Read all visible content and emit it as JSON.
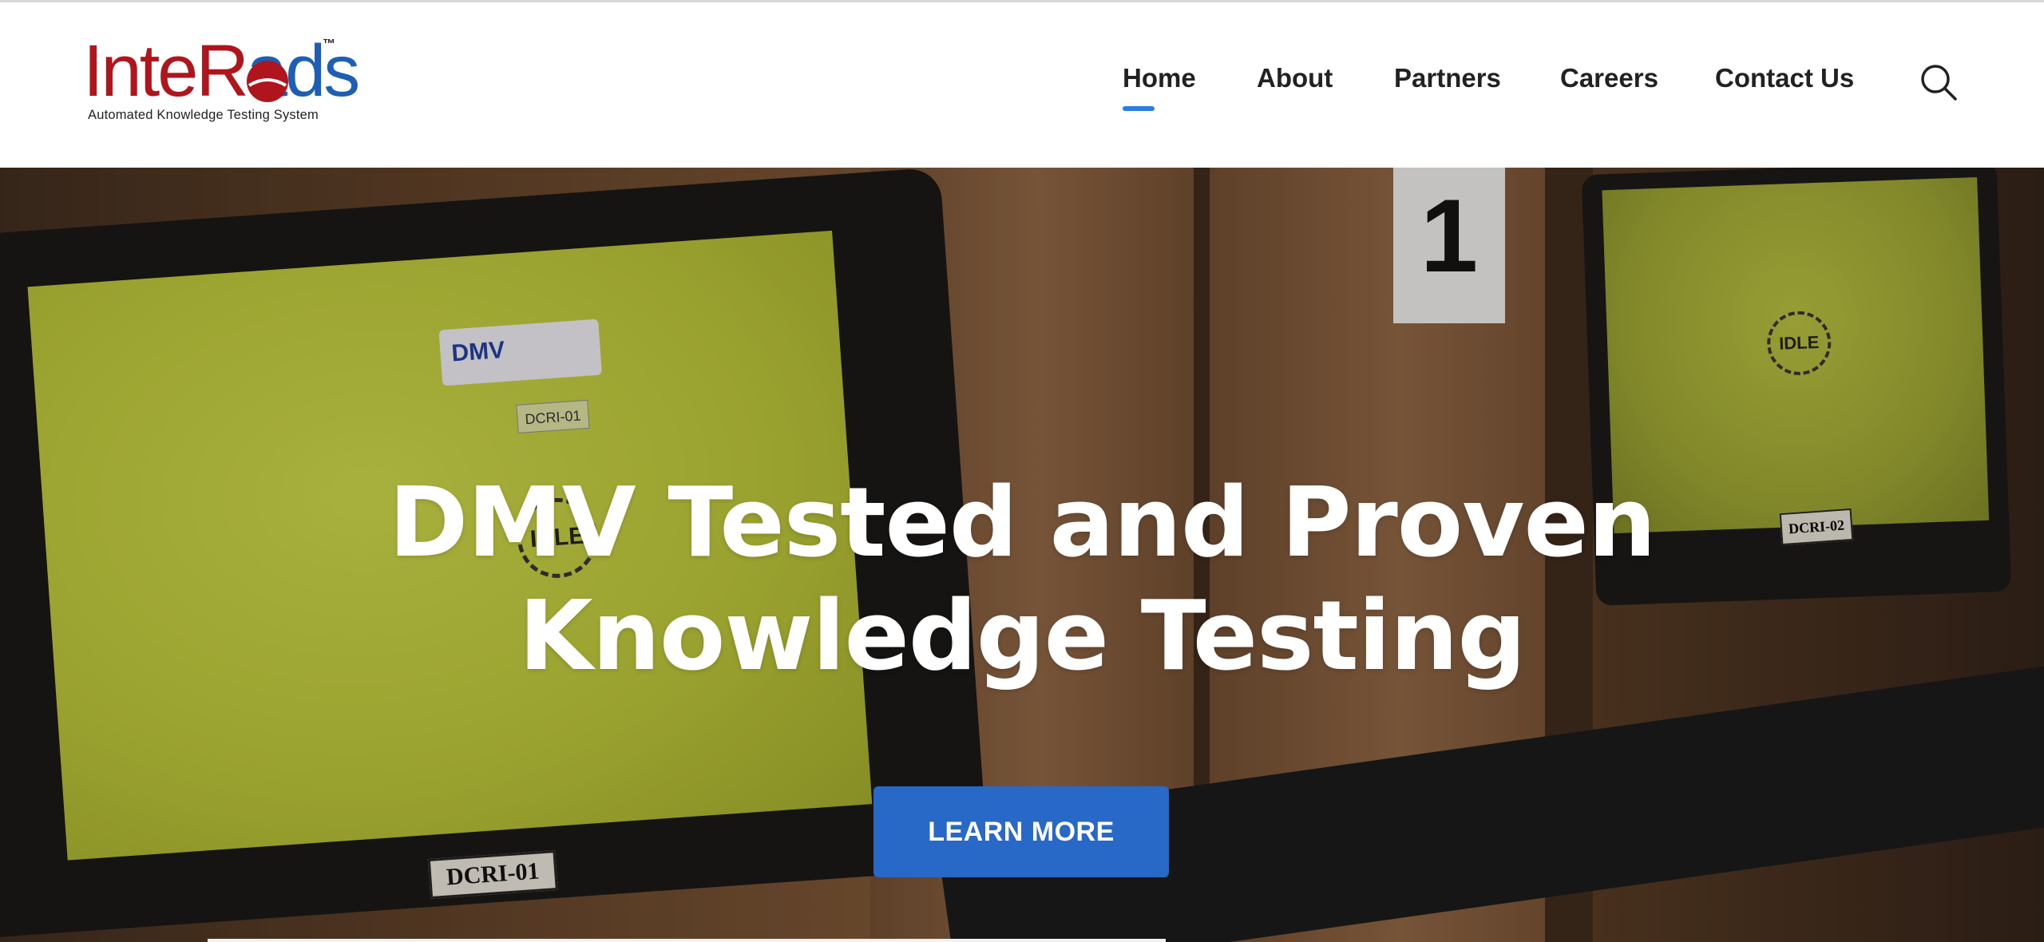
{
  "logo": {
    "part1": "Inte",
    "part2": "R",
    "part3": "ads",
    "tm": "™",
    "tagline": "Automated Knowledge Testing System"
  },
  "nav": {
    "items": [
      {
        "label": "Home",
        "active": true
      },
      {
        "label": "About",
        "active": false
      },
      {
        "label": "Partners",
        "active": false
      },
      {
        "label": "Careers",
        "active": false
      },
      {
        "label": "Contact Us",
        "active": false
      }
    ],
    "search_icon": "search-icon"
  },
  "hero": {
    "title_line1": "DMV Tested and Proven",
    "title_line2": "Knowledge Testing",
    "button_label": "LEARN MORE",
    "photo": {
      "dmv_badge": "DMV",
      "idle_text": "IDLE",
      "station_tag": "DCRI-01",
      "monitor_label": "DCRI-01",
      "monitor_label_right": "DCRI-02",
      "booth_number": "1"
    }
  },
  "colors": {
    "accent": "#2b7de0",
    "button": "#2869c7",
    "logo_blue": "#1e5fb4",
    "logo_red": "#b0151e"
  }
}
